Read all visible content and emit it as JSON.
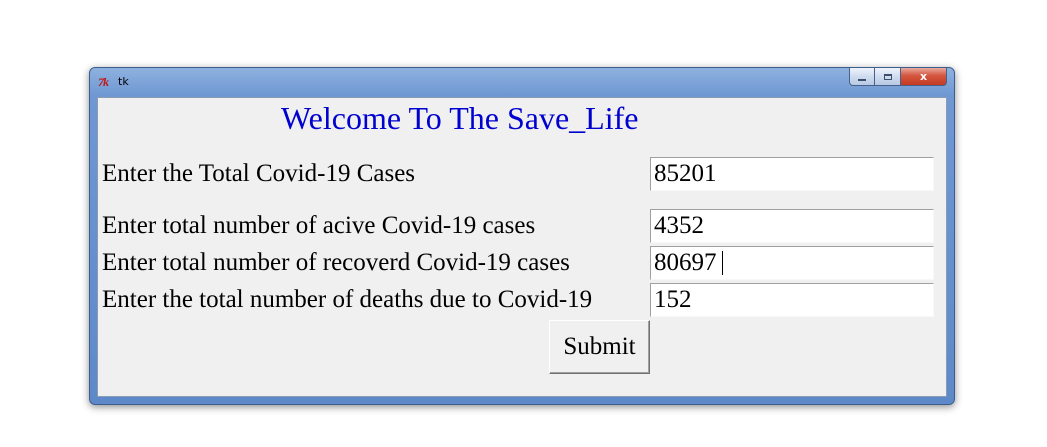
{
  "window": {
    "title": "tk",
    "icon": "tk-feather-icon",
    "logo_text": "7k",
    "close_glyph": "x",
    "close_color": "#c43a22"
  },
  "heading": {
    "text": "Welcome To The Save_Life",
    "color": "#0000d0"
  },
  "fields": [
    {
      "label": "Enter the Total Covid-19 Cases",
      "value": "85201"
    },
    {
      "label": "Enter total number of acive Covid-19  cases",
      "value": "4352"
    },
    {
      "label": "Enter total number of recoverd  Covid-19  cases",
      "value": "80697"
    },
    {
      "label": "Enter the total number of  deaths due to Covid-19",
      "value": "152"
    }
  ],
  "submit": {
    "label": "Submit"
  }
}
